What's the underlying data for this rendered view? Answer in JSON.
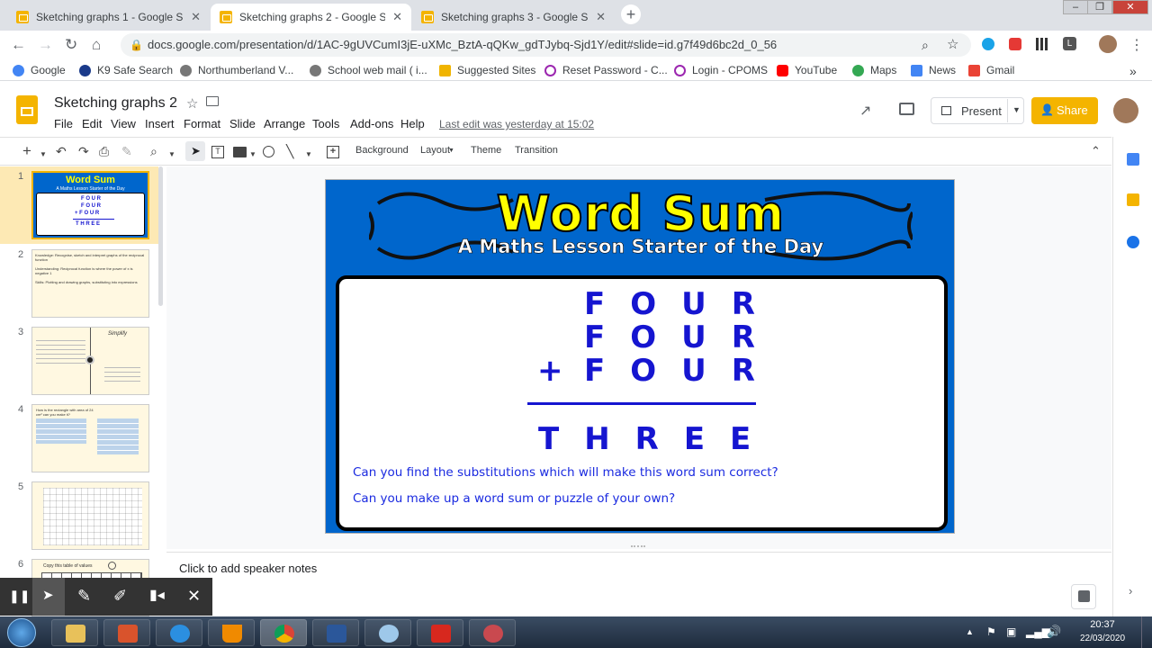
{
  "browser": {
    "tabs": [
      {
        "title": "Sketching graphs 1 - Google Slid",
        "close": "✕"
      },
      {
        "title": "Sketching graphs 2 - Google Slid",
        "close": "✕"
      },
      {
        "title": "Sketching graphs 3 - Google Slid",
        "close": "✕"
      }
    ],
    "new_tab": "+",
    "url": "docs.google.com/presentation/d/1AC-9gUVCumI3jE-uXMc_BztA-qQKw_gdTJybq-Sjd1Y/edit#slide=id.g7f49d6bc2d_0_56",
    "bookmarks": [
      "Google",
      "K9 Safe Search",
      "Northumberland V...",
      "School web mail ( i...",
      "Suggested Sites",
      "Reset Password - C...",
      "Login - CPOMS",
      "YouTube",
      "Maps",
      "News",
      "Gmail"
    ],
    "more": "»"
  },
  "app": {
    "doc_title": "Sketching graphs 2",
    "menus": [
      "File",
      "Edit",
      "View",
      "Insert",
      "Format",
      "Slide",
      "Arrange",
      "Tools",
      "Add-ons",
      "Help"
    ],
    "last_edit": "Last edit was yesterday at 15:02",
    "present_label": "Present",
    "share_label": "Share",
    "toolbar": {
      "background": "Background",
      "layout": "Layout",
      "theme": "Theme",
      "transition": "Transition"
    }
  },
  "filmstrip": {
    "numbers": [
      "1",
      "2",
      "3",
      "4",
      "5",
      "6"
    ],
    "thumb1_title": "Word Sum",
    "thumb1_sub": "A Maths Lesson Starter of the Day",
    "thumb1_words": [
      "F O U R",
      "F O U R",
      "+ F O U R",
      "T H R E E"
    ],
    "thumb2_lines": [
      "Knowledge: Recognise, sketch and interpret graphs of the reciprocal function",
      "Understanding: Reciprocal function is where the power of x is negative 1",
      "Skills: Plotting and drawing graphs, substituting into expressions"
    ],
    "thumb3_title": "Simplify",
    "thumb4_title": "How is the rectangle with area of 24 cm² can you make it?",
    "thumb6_title": "Copy this table of values"
  },
  "slide": {
    "title": "Word Sum",
    "subtitle": "A Maths Lesson Starter of the Day",
    "row1": "FOUR",
    "row2": "FOUR",
    "plus": "+",
    "row3": "FOUR",
    "result": "THREE",
    "question1": "Can you find the substitutions which will make this word sum correct?",
    "question2": "Can you make up a word sum or puzzle of your own?"
  },
  "notes": {
    "placeholder": "Click to add speaker notes"
  },
  "taskbar": {
    "time": "20:37",
    "date": "22/03/2020"
  },
  "colors": {
    "accent": "#f4b400",
    "slide_bg": "#0066cc",
    "word_blue": "#1515d0",
    "title_yellow": "#ffff00"
  }
}
